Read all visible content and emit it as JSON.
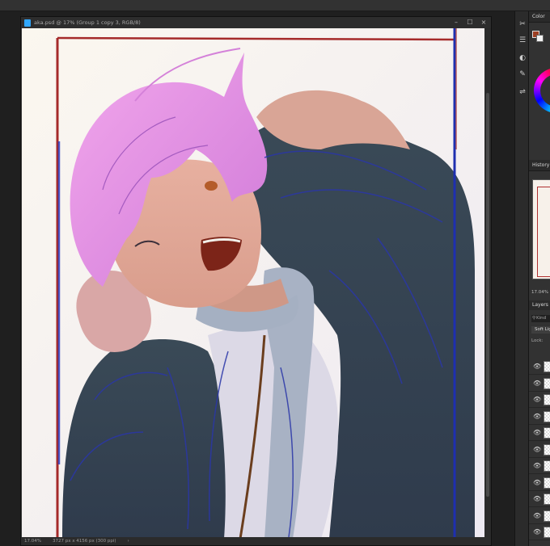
{
  "document": {
    "title": "aka.psd @ 17% (Group 1 copy 3, RGB/8)",
    "controls": {
      "minimize": "–",
      "maximize": "☐",
      "close": "×"
    },
    "status": {
      "zoom": "17.04%",
      "dimensions": "3727 px x 4156 px (300 ppi)",
      "arrow": "›"
    }
  },
  "panels": {
    "color_tab": "Color",
    "history_tab": "History",
    "navigator_zoom": "17.04%",
    "layers_tab": "Layers",
    "layer_filter": "Kind",
    "blend_mode": "Soft Light",
    "lock_label": "Lock:",
    "layers": [
      "",
      "",
      "",
      "",
      "",
      "",
      "",
      "",
      "",
      "",
      ""
    ]
  },
  "colors": {
    "foreground": "#9c3e22",
    "background": "#f2f2f2",
    "frame_red": "#a52a2a",
    "frame_blue": "#1e2fb0",
    "hair_pink": "#e58fe0",
    "jacket": "#34424f"
  },
  "icons": [
    "photoshop-document-icon",
    "scissors-icon",
    "sliders-icon",
    "contrast-icon",
    "brush-icon",
    "adjust-icon",
    "eye-icon",
    "search-icon"
  ]
}
